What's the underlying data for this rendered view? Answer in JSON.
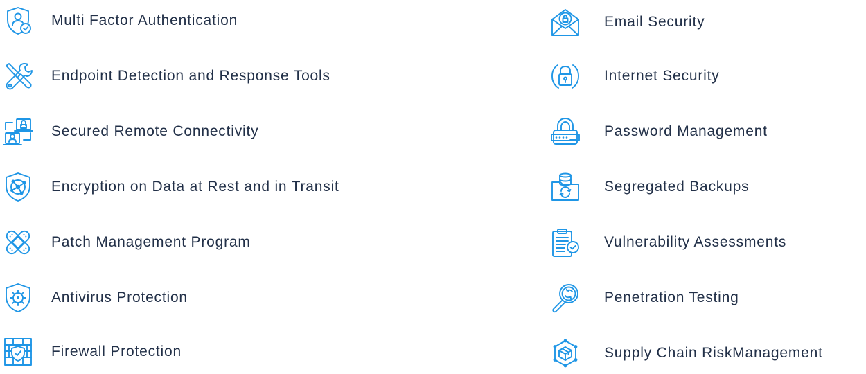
{
  "accent_color": "#1f96e6",
  "text_color": "#223048",
  "left_column": [
    {
      "label": "Multi Factor Authentication",
      "icon": "user-shield-check-icon"
    },
    {
      "label": "Endpoint Detection and Response Tools",
      "icon": "wrench-screwdriver-icon"
    },
    {
      "label": "Secured Remote Connectivity",
      "icon": "remote-computers-lock-icon"
    },
    {
      "label": "Encryption on Data at Rest and in Transit",
      "icon": "shield-network-icon"
    },
    {
      "label": "Patch Management Program",
      "icon": "bandage-patch-icon"
    },
    {
      "label": "Antivirus Protection",
      "icon": "shield-virus-icon"
    },
    {
      "label": "Firewall Protection",
      "icon": "firewall-shield-icon"
    }
  ],
  "right_column": [
    {
      "label": "Email Security",
      "icon": "email-lock-icon"
    },
    {
      "label": "Internet Security",
      "icon": "padlock-circle-icon"
    },
    {
      "label": "Password Management",
      "icon": "password-lock-icon"
    },
    {
      "label": "Segregated Backups",
      "icon": "database-folder-backup-icon"
    },
    {
      "label": "Vulnerability Assessments",
      "icon": "clipboard-check-icon"
    },
    {
      "label": "Penetration Testing",
      "icon": "magnifier-refresh-icon"
    },
    {
      "label": "Supply Chain RiskManagement",
      "icon": "network-package-icon"
    }
  ]
}
